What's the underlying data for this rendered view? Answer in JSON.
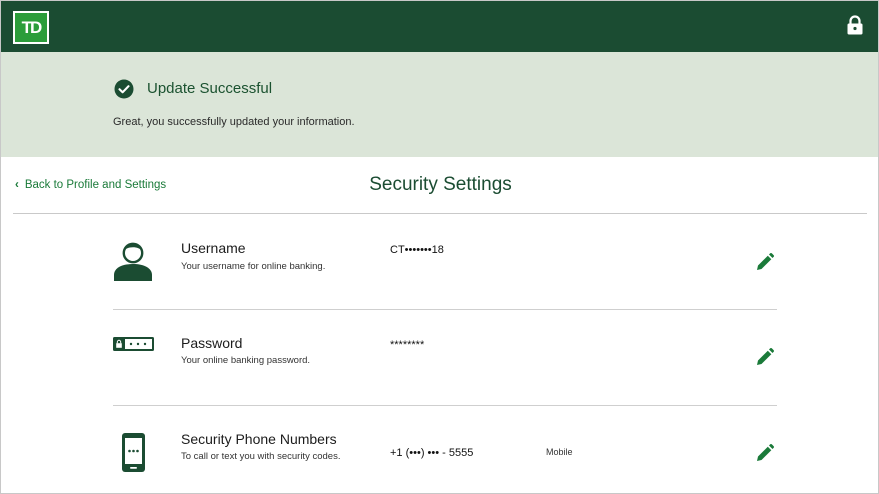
{
  "header": {
    "logo_text": "TD",
    "lock_icon": "lock-icon",
    "colors": {
      "bar": "#1b4c32",
      "logo": "#2b9d3a"
    }
  },
  "banner": {
    "title": "Update Successful",
    "message": "Great, you successfully updated your information.",
    "icon": "check-circle-icon",
    "background": "#dbe5d8"
  },
  "nav": {
    "back_label": "Back to Profile and Settings"
  },
  "page": {
    "title": "Security Settings"
  },
  "settings": [
    {
      "label": "Username",
      "description": "Your username for online banking.",
      "value": "CT•••••••18",
      "type": "",
      "icon": "user-icon",
      "action": "edit-icon"
    },
    {
      "label": "Password",
      "description": "Your online banking password.",
      "value": "********",
      "type": "",
      "icon": "password-icon",
      "action": "edit-icon"
    },
    {
      "label": "Security Phone Numbers",
      "description": "To call or text you with security codes.",
      "value": "+1 (•••) ••• - 5555",
      "type": "Mobile",
      "icon": "mobile-phone-icon",
      "action": "edit-icon"
    }
  ],
  "accent_color": "#1a7a39"
}
